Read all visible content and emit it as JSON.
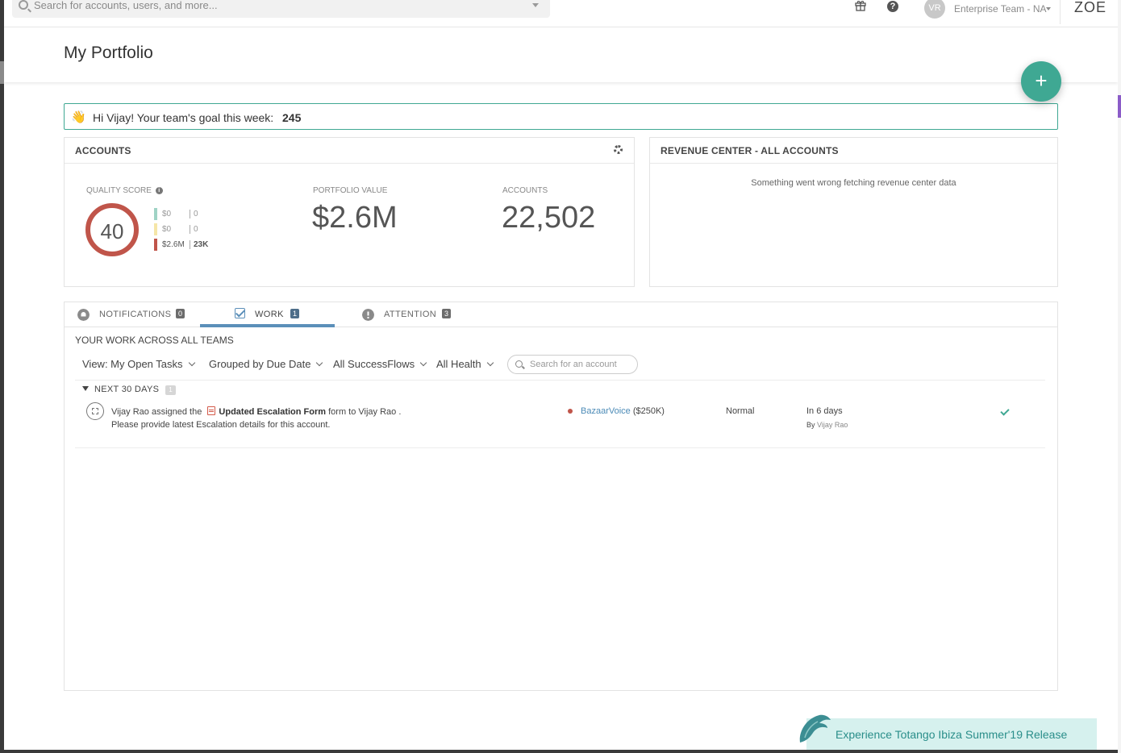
{
  "topbar": {
    "search_placeholder": "Search for accounts, users, and more...",
    "avatar_initials": "VR",
    "team": "Enterprise Team - NA",
    "brand": "ZOE",
    "help_glyph": "?"
  },
  "page": {
    "title": "My Portfolio",
    "add_glyph": "+"
  },
  "goal": {
    "emoji": "👋",
    "text": "Hi Vijay! Your team's goal this week:",
    "value": "245"
  },
  "accounts_card": {
    "title": "ACCOUNTS",
    "quality_label": "QUALITY SCORE",
    "quality_score": "40",
    "legend": [
      {
        "value": "$0",
        "count": "0",
        "color": "#9fd3c5"
      },
      {
        "value": "$0",
        "count": "0",
        "color": "#f5e6a8"
      },
      {
        "value": "$2.6M",
        "count": "23K",
        "color": "#c0554a"
      }
    ],
    "portfolio_label": "PORTFOLIO VALUE",
    "portfolio_value": "$2.6M",
    "accounts_label": "ACCOUNTS",
    "accounts_value": "22,502"
  },
  "revenue_card": {
    "title": "REVENUE CENTER - ALL ACCOUNTS",
    "message": "Something went wrong fetching revenue center data"
  },
  "tabs": [
    {
      "label": "NOTIFICATIONS",
      "count": "0",
      "icon": "bell-icon"
    },
    {
      "label": "WORK",
      "count": "1",
      "icon": "checkbox-icon",
      "active": true
    },
    {
      "label": "ATTENTION",
      "count": "3",
      "icon": "alert-icon"
    }
  ],
  "work": {
    "title": "YOUR WORK ACROSS ALL TEAMS",
    "filters": {
      "view": "View: My Open Tasks",
      "group": "Grouped by Due Date",
      "flows": "All SuccessFlows",
      "health": "All Health"
    },
    "account_search_placeholder": "Search for an account",
    "group_label": "NEXT 30 DAYS",
    "group_count": "1",
    "task": {
      "assigner": "Vijay Rao",
      "action": "assigned the",
      "form_name": "Updated Escalation Form",
      "form_word": "form to",
      "assignee": "Vijay Rao",
      "period": ".",
      "description": "Please provide latest Escalation details for this account.",
      "account": "BazaarVoice",
      "account_value": "($250K)",
      "priority": "Normal",
      "due": "In 6 days",
      "by_label": "By",
      "by_name": "Vijay Rao"
    }
  },
  "promo": {
    "text": "Experience Totango Ibiza Summer'19 Release"
  },
  "colors": {
    "accent": "#3fa893",
    "tab_active": "#5b8fb9",
    "health_red": "#c0554a",
    "link": "#4c8bb7"
  }
}
